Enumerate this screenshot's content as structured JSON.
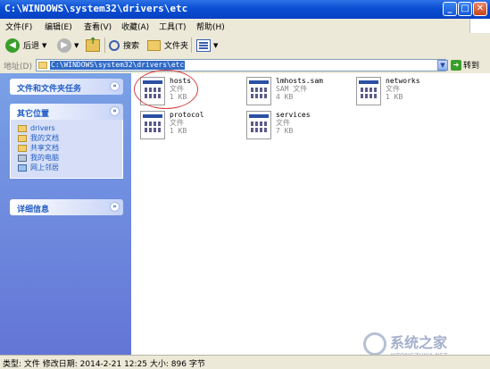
{
  "window": {
    "title": "C:\\WINDOWS\\system32\\drivers\\etc",
    "minimize": "_",
    "maximize": "□",
    "close": "✕"
  },
  "menu": [
    "文件(F)",
    "编辑(E)",
    "查看(V)",
    "收藏(A)",
    "工具(T)",
    "帮助(H)"
  ],
  "toolbar": {
    "back_label": "后退",
    "back_icon": "back-arrow-icon",
    "forward_icon": "forward-arrow-icon",
    "up_icon": "up-folder-icon",
    "search_label": "搜索",
    "search_icon": "search-icon",
    "folders_label": "文件夹",
    "folders_icon": "folders-icon",
    "views_icon": "views-icon"
  },
  "address": {
    "label": "地址(D)",
    "value": "C:\\WINDOWS\\system32\\drivers\\etc",
    "go_label": "转到"
  },
  "sidebar": {
    "tasks_header": "文件和文件夹任务",
    "places_header": "其它位置",
    "places": [
      {
        "label": "drivers",
        "icon": "folder-icon"
      },
      {
        "label": "我的文档",
        "icon": "my-documents-icon"
      },
      {
        "label": "共享文档",
        "icon": "shared-documents-icon"
      },
      {
        "label": "我的电脑",
        "icon": "my-computer-icon"
      },
      {
        "label": "网上邻居",
        "icon": "network-places-icon"
      }
    ],
    "details_header": "详细信息"
  },
  "files": [
    {
      "name": "hosts",
      "type": "文件",
      "size": "1 KB"
    },
    {
      "name": "lmhosts.sam",
      "type": "SAM 文件",
      "size": "4 KB"
    },
    {
      "name": "networks",
      "type": "文件",
      "size": "1 KB"
    },
    {
      "name": "protocol",
      "type": "文件",
      "size": "1 KB"
    },
    {
      "name": "services",
      "type": "文件",
      "size": "7 KB"
    }
  ],
  "status": {
    "text": "类型: 文件 修改日期: 2014-2-21 12:25 大小: 896 字节"
  },
  "watermark": {
    "text": "系统之家",
    "sub": "XITONGZHIJIA.NET"
  },
  "colors": {
    "titlebar": "#0a4fd3",
    "sidebar": "#6f8ce0",
    "highlight": "#316ac5",
    "annotation": "#d84040"
  }
}
